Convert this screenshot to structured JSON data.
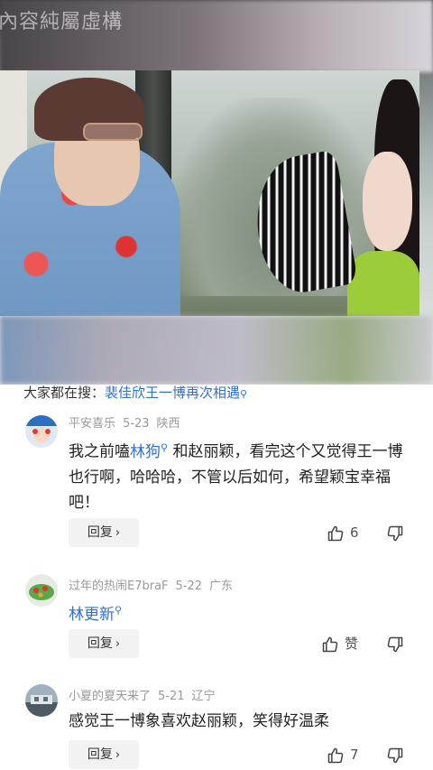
{
  "video": {
    "watermark": "內容純屬虛構"
  },
  "search_bar": {
    "prefix": "大家都在搜：",
    "term": "裴佳欣王一博再次相遇",
    "term_icon": "search-icon"
  },
  "comments": [
    {
      "user": "平安喜乐",
      "date": "5-23",
      "location": "陕西",
      "text_before": "我之前嗑",
      "link": "林狗",
      "text_after": "和赵丽颖，看完这个又觉得王一博也行啊，哈哈哈，不管以后如何，希望颖宝幸福吧！",
      "reply_label": "回复",
      "likes": "6"
    },
    {
      "user": "过年的热闹E7braF",
      "date": "5-22",
      "location": "广东",
      "text_before": "",
      "link": "林更新",
      "text_after": "",
      "reply_label": "回复",
      "likes": "赞"
    },
    {
      "user": "小夏的夏天来了",
      "date": "5-21",
      "location": "辽宁",
      "text_before": "感觉王一博象喜欢赵丽颖，笑得好温柔",
      "link": "",
      "text_after": "",
      "reply_label": "回复",
      "likes": "7"
    }
  ],
  "colors": {
    "link": "#2f6fd6",
    "meta": "#999999",
    "reply_bg": "#f2f2f2"
  }
}
